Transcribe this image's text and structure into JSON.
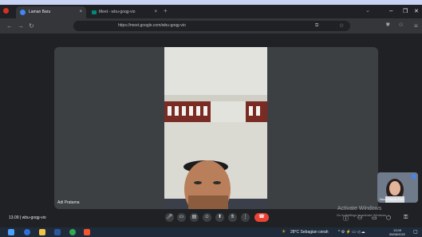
{
  "browser": {
    "tabs": [
      {
        "label": "Laman Baru",
        "close": "×"
      },
      {
        "label": "Meet - wbu-goqg-vio",
        "close": "×"
      }
    ],
    "new_tab": "+",
    "url": "https://meet.google.com/wbu-goqg-vio",
    "window_controls": {
      "minimize": "–",
      "maximize": "❐",
      "close": "✕"
    }
  },
  "meet": {
    "participant_name": "Adi Pratama",
    "self_name": "Nurul Melati Putri",
    "meeting_time": "13.09",
    "meeting_code": "wbu-goqg-vio",
    "control_icons": [
      "mic-icon",
      "camera-icon",
      "captions-icon",
      "emoji-icon",
      "present-icon",
      "hand-icon",
      "more-icon"
    ],
    "end_call_icon": "end-call-icon"
  },
  "watermark": {
    "title": "Activate Windows",
    "subtitle": "Go to Settings to activate Windows."
  },
  "taskbar": {
    "weather": "28°C  Sebagian cerah",
    "time": "13.09",
    "date": "05/08/2022",
    "apps": [
      "start",
      "search",
      "files",
      "edge",
      "chrome",
      "brave"
    ]
  },
  "colors": {
    "end_call": "#ea4335",
    "chrome_bg": "#202124",
    "accent": "#8ab4f8"
  }
}
